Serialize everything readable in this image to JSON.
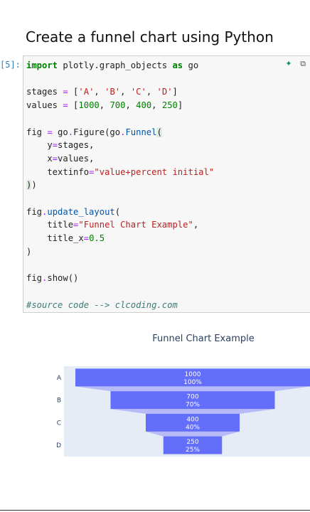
{
  "heading": "Create a funnel chart using Python",
  "cell": {
    "prompt": "[5]:",
    "lines": [
      [
        {
          "t": "import",
          "c": "kw"
        },
        {
          "t": " plotly.graph_objects "
        },
        {
          "t": "as",
          "c": "kw"
        },
        {
          "t": " go"
        }
      ],
      [],
      [
        {
          "t": "stages "
        },
        {
          "t": "=",
          "c": "op"
        },
        {
          "t": " ["
        },
        {
          "t": "'A'",
          "c": "str"
        },
        {
          "t": ", "
        },
        {
          "t": "'B'",
          "c": "str"
        },
        {
          "t": ", "
        },
        {
          "t": "'C'",
          "c": "str"
        },
        {
          "t": ", "
        },
        {
          "t": "'D'",
          "c": "str"
        },
        {
          "t": "]"
        }
      ],
      [
        {
          "t": "values "
        },
        {
          "t": "=",
          "c": "op"
        },
        {
          "t": " ["
        },
        {
          "t": "1000",
          "c": "num"
        },
        {
          "t": ", "
        },
        {
          "t": "700",
          "c": "num"
        },
        {
          "t": ", "
        },
        {
          "t": "400",
          "c": "num"
        },
        {
          "t": ", "
        },
        {
          "t": "250",
          "c": "num"
        },
        {
          "t": "]"
        }
      ],
      [],
      [
        {
          "t": "fig "
        },
        {
          "t": "=",
          "c": "op"
        },
        {
          "t": " go"
        },
        {
          "t": ".",
          "c": "op"
        },
        {
          "t": "Figure(go"
        },
        {
          "t": ".",
          "c": "op"
        },
        {
          "t": "Funnel",
          "c": "fn"
        },
        {
          "t": "(",
          "c": "bracket-hl"
        }
      ],
      [
        {
          "t": "    y"
        },
        {
          "t": "=",
          "c": "op"
        },
        {
          "t": "stages,"
        }
      ],
      [
        {
          "t": "    x"
        },
        {
          "t": "=",
          "c": "op"
        },
        {
          "t": "values,"
        }
      ],
      [
        {
          "t": "    textinfo"
        },
        {
          "t": "=",
          "c": "op"
        },
        {
          "t": "\"value+percent initial\"",
          "c": "str"
        }
      ],
      [
        {
          "t": ")",
          "c": "bracket-hl"
        },
        {
          "t": ")"
        }
      ],
      [],
      [
        {
          "t": "fig"
        },
        {
          "t": ".",
          "c": "op"
        },
        {
          "t": "update_layout",
          "c": "fn"
        },
        {
          "t": "("
        }
      ],
      [
        {
          "t": "    title"
        },
        {
          "t": "=",
          "c": "op"
        },
        {
          "t": "\"Funnel Chart Example\"",
          "c": "str"
        },
        {
          "t": ","
        }
      ],
      [
        {
          "t": "    title_x"
        },
        {
          "t": "=",
          "c": "op"
        },
        {
          "t": "0.5",
          "c": "num"
        }
      ],
      [
        {
          "t": ")"
        }
      ],
      [],
      [
        {
          "t": "fig"
        },
        {
          "t": ".",
          "c": "op"
        },
        {
          "t": "show()"
        }
      ],
      [],
      [
        {
          "t": "#source code --> clcoding.com",
          "c": "cm"
        }
      ]
    ],
    "tools": {
      "sparkle_icon": "sparkle-icon",
      "copy_icon": "copy-icon"
    }
  },
  "chart_data": {
    "type": "funnel",
    "title": "Funnel Chart Example",
    "categories": [
      "A",
      "B",
      "C",
      "D"
    ],
    "values": [
      1000,
      700,
      400,
      250
    ],
    "percent_labels": [
      "100%",
      "70%",
      "40%",
      "25%"
    ],
    "bar_color": "#636efa",
    "connector_color": "#b6bbf8",
    "plot_bg": "#e5ecf6",
    "text_color": "#ffffff"
  }
}
